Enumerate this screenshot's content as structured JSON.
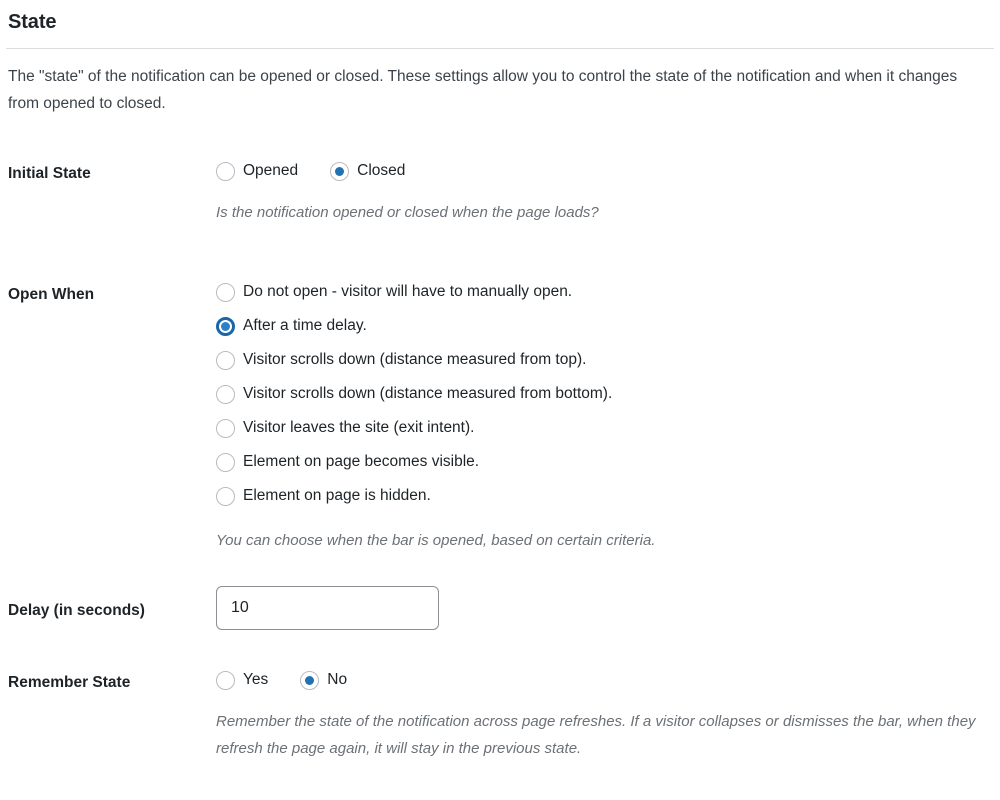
{
  "section": {
    "title": "State",
    "description": "The \"state\" of the notification can be opened or closed. These settings allow you to control the state of the notification and when it changes from opened to closed."
  },
  "initial_state": {
    "label": "Initial State",
    "options": [
      {
        "label": "Opened",
        "checked": false
      },
      {
        "label": "Closed",
        "checked": true
      }
    ],
    "help": "Is the notification opened or closed when the page loads?"
  },
  "open_when": {
    "label": "Open When",
    "options": [
      {
        "label": "Do not open - visitor will have to manually open.",
        "checked": false
      },
      {
        "label": "After a time delay.",
        "checked": true
      },
      {
        "label": "Visitor scrolls down (distance measured from top).",
        "checked": false
      },
      {
        "label": "Visitor scrolls down (distance measured from bottom).",
        "checked": false
      },
      {
        "label": "Visitor leaves the site (exit intent).",
        "checked": false
      },
      {
        "label": "Element on page becomes visible.",
        "checked": false
      },
      {
        "label": "Element on page is hidden.",
        "checked": false
      }
    ],
    "help": "You can choose when the bar is opened, based on certain criteria."
  },
  "delay": {
    "label": "Delay (in seconds)",
    "value": "10",
    "placeholder": ""
  },
  "remember_state": {
    "label": "Remember State",
    "options": [
      {
        "label": "Yes",
        "checked": false
      },
      {
        "label": "No",
        "checked": true
      }
    ],
    "help": "Remember the state of the notification across page refreshes. If a visitor collapses or dismisses the bar, when they refresh the page again, it will stay in the previous state."
  },
  "colors": {
    "accent": "#2271b1",
    "focus_ring": "#1b66a8",
    "divider": "#dcdcde",
    "help_text": "#6b7177",
    "body_text": "#1d2327"
  }
}
